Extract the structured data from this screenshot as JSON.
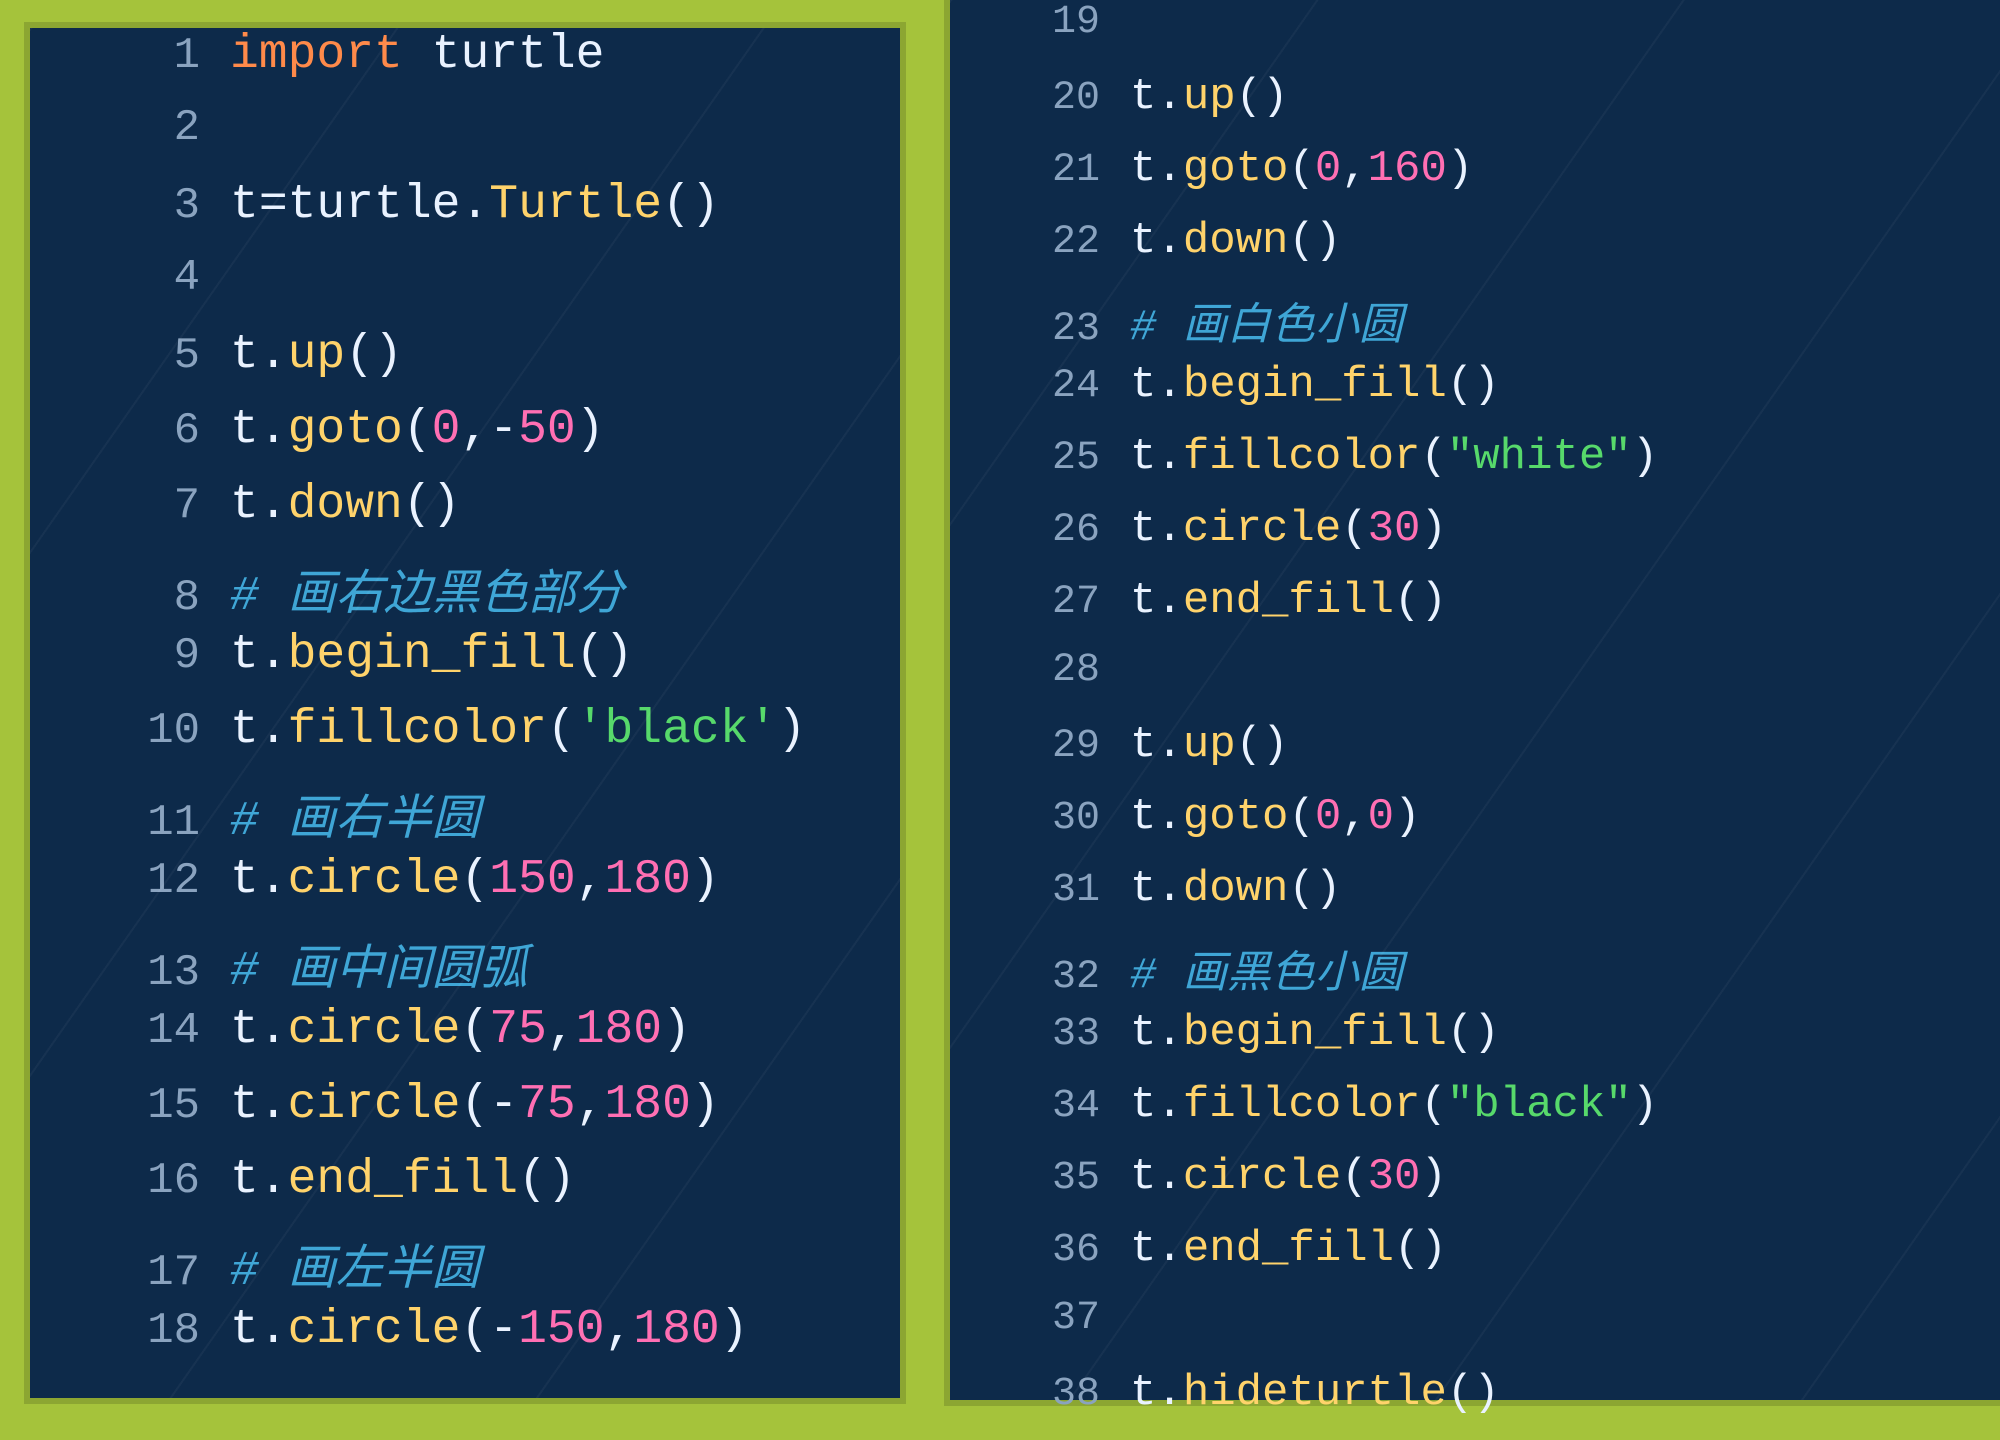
{
  "panels": {
    "left": {
      "start": 1,
      "lines": [
        [
          {
            "c": "tk-keyword",
            "t": "import"
          },
          {
            "c": "tk-punct",
            "t": " "
          },
          {
            "c": "tk-ident",
            "t": "turtle"
          }
        ],
        [],
        [
          {
            "c": "tk-ident",
            "t": "t"
          },
          {
            "c": "tk-punct",
            "t": "="
          },
          {
            "c": "tk-ident",
            "t": "turtle"
          },
          {
            "c": "tk-punct",
            "t": "."
          },
          {
            "c": "tk-class",
            "t": "Turtle"
          },
          {
            "c": "tk-punct",
            "t": "()"
          }
        ],
        [],
        [
          {
            "c": "tk-ident",
            "t": "t"
          },
          {
            "c": "tk-punct",
            "t": "."
          },
          {
            "c": "tk-func",
            "t": "up"
          },
          {
            "c": "tk-punct",
            "t": "()"
          }
        ],
        [
          {
            "c": "tk-ident",
            "t": "t"
          },
          {
            "c": "tk-punct",
            "t": "."
          },
          {
            "c": "tk-func",
            "t": "goto"
          },
          {
            "c": "tk-punct",
            "t": "("
          },
          {
            "c": "tk-num",
            "t": "0"
          },
          {
            "c": "tk-punct",
            "t": ","
          },
          {
            "c": "tk-punct",
            "t": "-"
          },
          {
            "c": "tk-num",
            "t": "50"
          },
          {
            "c": "tk-punct",
            "t": ")"
          }
        ],
        [
          {
            "c": "tk-ident",
            "t": "t"
          },
          {
            "c": "tk-punct",
            "t": "."
          },
          {
            "c": "tk-func",
            "t": "down"
          },
          {
            "c": "tk-punct",
            "t": "()"
          }
        ],
        [
          {
            "c": "tk-comment",
            "t": "# 画右边黑色部分"
          }
        ],
        [
          {
            "c": "tk-ident",
            "t": "t"
          },
          {
            "c": "tk-punct",
            "t": "."
          },
          {
            "c": "tk-func",
            "t": "begin_fill"
          },
          {
            "c": "tk-punct",
            "t": "()"
          }
        ],
        [
          {
            "c": "tk-ident",
            "t": "t"
          },
          {
            "c": "tk-punct",
            "t": "."
          },
          {
            "c": "tk-func",
            "t": "fillcolor"
          },
          {
            "c": "tk-punct",
            "t": "("
          },
          {
            "c": "tk-str",
            "t": "'black'"
          },
          {
            "c": "tk-punct",
            "t": ")"
          }
        ],
        [
          {
            "c": "tk-comment",
            "t": "# 画右半圆"
          }
        ],
        [
          {
            "c": "tk-ident",
            "t": "t"
          },
          {
            "c": "tk-punct",
            "t": "."
          },
          {
            "c": "tk-func",
            "t": "circle"
          },
          {
            "c": "tk-punct",
            "t": "("
          },
          {
            "c": "tk-num",
            "t": "150"
          },
          {
            "c": "tk-punct",
            "t": ","
          },
          {
            "c": "tk-num",
            "t": "180"
          },
          {
            "c": "tk-punct",
            "t": ")"
          }
        ],
        [
          {
            "c": "tk-comment",
            "t": "# 画中间圆弧"
          }
        ],
        [
          {
            "c": "tk-ident",
            "t": "t"
          },
          {
            "c": "tk-punct",
            "t": "."
          },
          {
            "c": "tk-func",
            "t": "circle"
          },
          {
            "c": "tk-punct",
            "t": "("
          },
          {
            "c": "tk-num",
            "t": "75"
          },
          {
            "c": "tk-punct",
            "t": ","
          },
          {
            "c": "tk-num",
            "t": "180"
          },
          {
            "c": "tk-punct",
            "t": ")"
          }
        ],
        [
          {
            "c": "tk-ident",
            "t": "t"
          },
          {
            "c": "tk-punct",
            "t": "."
          },
          {
            "c": "tk-func",
            "t": "circle"
          },
          {
            "c": "tk-punct",
            "t": "("
          },
          {
            "c": "tk-punct",
            "t": "-"
          },
          {
            "c": "tk-num",
            "t": "75"
          },
          {
            "c": "tk-punct",
            "t": ","
          },
          {
            "c": "tk-num",
            "t": "180"
          },
          {
            "c": "tk-punct",
            "t": ")"
          }
        ],
        [
          {
            "c": "tk-ident",
            "t": "t"
          },
          {
            "c": "tk-punct",
            "t": "."
          },
          {
            "c": "tk-func",
            "t": "end_fill"
          },
          {
            "c": "tk-punct",
            "t": "()"
          }
        ],
        [
          {
            "c": "tk-comment",
            "t": "# 画左半圆"
          }
        ],
        [
          {
            "c": "tk-ident",
            "t": "t"
          },
          {
            "c": "tk-punct",
            "t": "."
          },
          {
            "c": "tk-func",
            "t": "circle"
          },
          {
            "c": "tk-punct",
            "t": "("
          },
          {
            "c": "tk-punct",
            "t": "-"
          },
          {
            "c": "tk-num",
            "t": "150"
          },
          {
            "c": "tk-punct",
            "t": ","
          },
          {
            "c": "tk-num",
            "t": "180"
          },
          {
            "c": "tk-punct",
            "t": ")"
          }
        ]
      ]
    },
    "right": {
      "start": 19,
      "lines": [
        [],
        [
          {
            "c": "tk-ident",
            "t": "t"
          },
          {
            "c": "tk-punct",
            "t": "."
          },
          {
            "c": "tk-func",
            "t": "up"
          },
          {
            "c": "tk-punct",
            "t": "()"
          }
        ],
        [
          {
            "c": "tk-ident",
            "t": "t"
          },
          {
            "c": "tk-punct",
            "t": "."
          },
          {
            "c": "tk-func",
            "t": "goto"
          },
          {
            "c": "tk-punct",
            "t": "("
          },
          {
            "c": "tk-num",
            "t": "0"
          },
          {
            "c": "tk-punct",
            "t": ","
          },
          {
            "c": "tk-num",
            "t": "160"
          },
          {
            "c": "tk-punct",
            "t": ")"
          }
        ],
        [
          {
            "c": "tk-ident",
            "t": "t"
          },
          {
            "c": "tk-punct",
            "t": "."
          },
          {
            "c": "tk-func",
            "t": "down"
          },
          {
            "c": "tk-punct",
            "t": "()"
          }
        ],
        [
          {
            "c": "tk-comment",
            "t": "# 画白色小圆"
          }
        ],
        [
          {
            "c": "tk-ident",
            "t": "t"
          },
          {
            "c": "tk-punct",
            "t": "."
          },
          {
            "c": "tk-func",
            "t": "begin_fill"
          },
          {
            "c": "tk-punct",
            "t": "()"
          }
        ],
        [
          {
            "c": "tk-ident",
            "t": "t"
          },
          {
            "c": "tk-punct",
            "t": "."
          },
          {
            "c": "tk-func",
            "t": "fillcolor"
          },
          {
            "c": "tk-punct",
            "t": "("
          },
          {
            "c": "tk-str",
            "t": "\"white\""
          },
          {
            "c": "tk-punct",
            "t": ")"
          }
        ],
        [
          {
            "c": "tk-ident",
            "t": "t"
          },
          {
            "c": "tk-punct",
            "t": "."
          },
          {
            "c": "tk-func",
            "t": "circle"
          },
          {
            "c": "tk-punct",
            "t": "("
          },
          {
            "c": "tk-num",
            "t": "30"
          },
          {
            "c": "tk-punct",
            "t": ")"
          }
        ],
        [
          {
            "c": "tk-ident",
            "t": "t"
          },
          {
            "c": "tk-punct",
            "t": "."
          },
          {
            "c": "tk-func",
            "t": "end_fill"
          },
          {
            "c": "tk-punct",
            "t": "()"
          }
        ],
        [],
        [
          {
            "c": "tk-ident",
            "t": "t"
          },
          {
            "c": "tk-punct",
            "t": "."
          },
          {
            "c": "tk-func",
            "t": "up"
          },
          {
            "c": "tk-punct",
            "t": "()"
          }
        ],
        [
          {
            "c": "tk-ident",
            "t": "t"
          },
          {
            "c": "tk-punct",
            "t": "."
          },
          {
            "c": "tk-func",
            "t": "goto"
          },
          {
            "c": "tk-punct",
            "t": "("
          },
          {
            "c": "tk-num",
            "t": "0"
          },
          {
            "c": "tk-punct",
            "t": ","
          },
          {
            "c": "tk-num",
            "t": "0"
          },
          {
            "c": "tk-punct",
            "t": ")"
          }
        ],
        [
          {
            "c": "tk-ident",
            "t": "t"
          },
          {
            "c": "tk-punct",
            "t": "."
          },
          {
            "c": "tk-func",
            "t": "down"
          },
          {
            "c": "tk-punct",
            "t": "()"
          }
        ],
        [
          {
            "c": "tk-comment",
            "t": "# 画黑色小圆"
          }
        ],
        [
          {
            "c": "tk-ident",
            "t": "t"
          },
          {
            "c": "tk-punct",
            "t": "."
          },
          {
            "c": "tk-func",
            "t": "begin_fill"
          },
          {
            "c": "tk-punct",
            "t": "()"
          }
        ],
        [
          {
            "c": "tk-ident",
            "t": "t"
          },
          {
            "c": "tk-punct",
            "t": "."
          },
          {
            "c": "tk-func",
            "t": "fillcolor"
          },
          {
            "c": "tk-punct",
            "t": "("
          },
          {
            "c": "tk-str",
            "t": "\"black\""
          },
          {
            "c": "tk-punct",
            "t": ")"
          }
        ],
        [
          {
            "c": "tk-ident",
            "t": "t"
          },
          {
            "c": "tk-punct",
            "t": "."
          },
          {
            "c": "tk-func",
            "t": "circle"
          },
          {
            "c": "tk-punct",
            "t": "("
          },
          {
            "c": "tk-num",
            "t": "30"
          },
          {
            "c": "tk-punct",
            "t": ")"
          }
        ],
        [
          {
            "c": "tk-ident",
            "t": "t"
          },
          {
            "c": "tk-punct",
            "t": "."
          },
          {
            "c": "tk-func",
            "t": "end_fill"
          },
          {
            "c": "tk-punct",
            "t": "()"
          }
        ],
        [],
        [
          {
            "c": "tk-ident",
            "t": "t"
          },
          {
            "c": "tk-punct",
            "t": "."
          },
          {
            "c": "tk-func",
            "t": "hideturtle"
          },
          {
            "c": "tk-punct",
            "t": "()"
          }
        ]
      ]
    }
  }
}
